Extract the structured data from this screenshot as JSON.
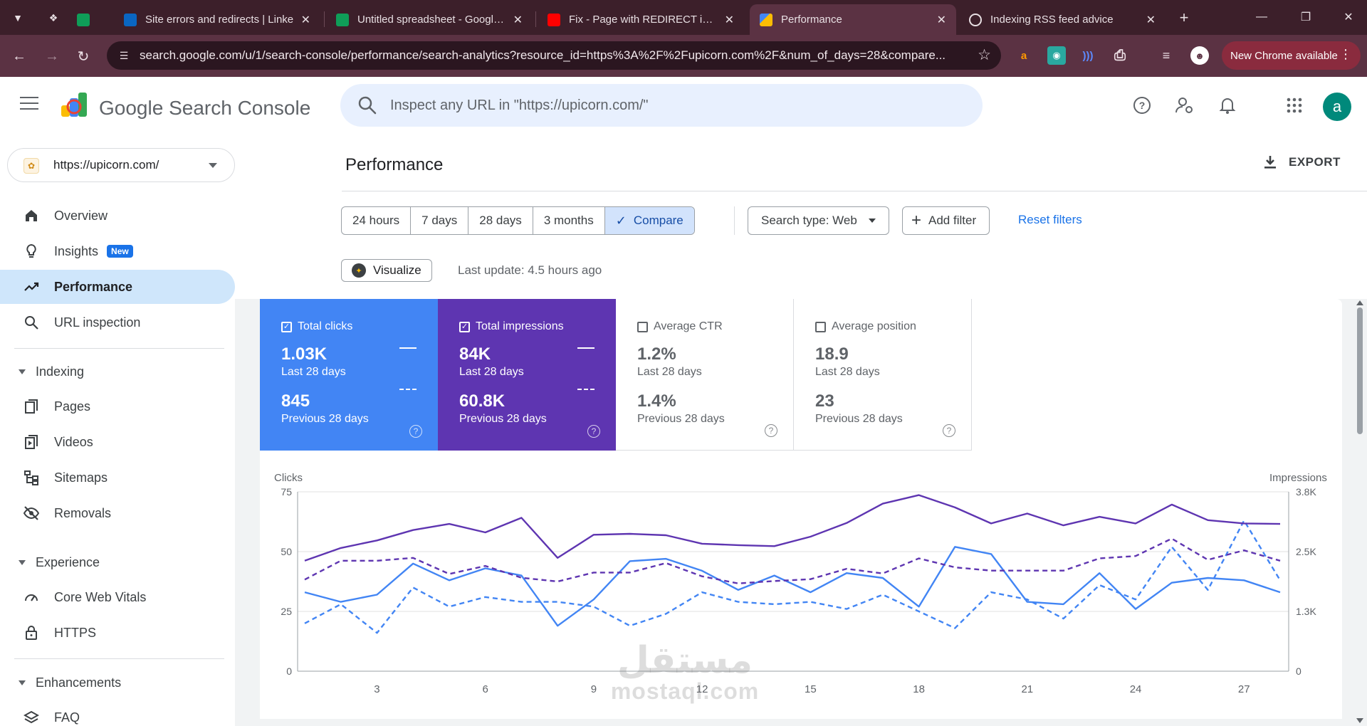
{
  "browser": {
    "tabs": [
      {
        "title": "Site errors and redirects | Linke",
        "icon": "linkedin-video-icon",
        "color": "#0a66c2"
      },
      {
        "title": "Untitled spreadsheet - Google S",
        "icon": "sheets-icon",
        "color": "#0f9d58"
      },
      {
        "title": "Fix - Page with REDIRECT in Go",
        "icon": "youtube-icon",
        "color": "#ff0000"
      },
      {
        "title": "Performance",
        "icon": "search-console-icon",
        "color": "#4285f4"
      },
      {
        "title": "Indexing RSS feed advice",
        "icon": "openai-icon",
        "color": "#e8dfe3"
      }
    ],
    "url": "search.google.com/u/1/search-console/performance/search-analytics?resource_id=https%3A%2F%2Fupicorn.com%2F&num_of_days=28&compare...",
    "update_label": "New Chrome available"
  },
  "header": {
    "app_name": "Google Search Console",
    "search_placeholder": "Inspect any URL in \"https://upicorn.com/\"",
    "avatar_letter": "a"
  },
  "sidebar": {
    "property": "https://upicorn.com/",
    "items": {
      "overview": "Overview",
      "insights": "Insights",
      "insights_badge": "New",
      "performance": "Performance",
      "url_inspection": "URL inspection"
    },
    "indexing": {
      "title": "Indexing",
      "pages": "Pages",
      "videos": "Videos",
      "sitemaps": "Sitemaps",
      "removals": "Removals"
    },
    "experience": {
      "title": "Experience",
      "cwv": "Core Web Vitals",
      "https": "HTTPS"
    },
    "enhancements": {
      "title": "Enhancements",
      "faq": "FAQ"
    }
  },
  "main": {
    "title": "Performance",
    "export_label": "EXPORT",
    "date_options": [
      "24 hours",
      "7 days",
      "28 days",
      "3 months",
      "Compare"
    ],
    "search_type": "Search type: Web",
    "add_filter": "Add filter",
    "reset_filters": "Reset filters",
    "visualize": "Visualize",
    "last_update": "Last update: 4.5 hours ago"
  },
  "metrics": [
    {
      "label": "Total clicks",
      "value": "1.03K",
      "period": "Last 28 days",
      "prev_value": "845",
      "prev_period": "Previous 28 days",
      "checked": true,
      "color": "#4285f4"
    },
    {
      "label": "Total impressions",
      "value": "84K",
      "period": "Last 28 days",
      "prev_value": "60.8K",
      "prev_period": "Previous 28 days",
      "checked": true,
      "color": "#5e35b1"
    },
    {
      "label": "Average CTR",
      "value": "1.2%",
      "period": "Last 28 days",
      "prev_value": "1.4%",
      "prev_period": "Previous 28 days",
      "checked": false
    },
    {
      "label": "Average position",
      "value": "18.9",
      "period": "Last 28 days",
      "prev_value": "23",
      "prev_period": "Previous 28 days",
      "checked": false
    }
  ],
  "chart_data": {
    "type": "line",
    "ylabel": "Clicks",
    "y2label": "Impressions",
    "ylim": [
      0,
      75
    ],
    "y2lim": [
      0,
      3800
    ],
    "yticks": [
      "0",
      "25",
      "50",
      "75"
    ],
    "y2ticks": [
      "0",
      "1.3K",
      "2.5K",
      "3.8K"
    ],
    "x": [
      1,
      2,
      3,
      4,
      5,
      6,
      7,
      8,
      9,
      10,
      11,
      12,
      13,
      14,
      15,
      16,
      17,
      18,
      19,
      20,
      21,
      22,
      23,
      24,
      25,
      26,
      27,
      28
    ],
    "xticks": [
      "3",
      "6",
      "9",
      "12",
      "15",
      "18",
      "21",
      "24",
      "27"
    ],
    "xtick_values": [
      3,
      6,
      9,
      12,
      15,
      18,
      21,
      24,
      27
    ],
    "series": [
      {
        "name": "Total clicks",
        "axis": "left",
        "dashed": false,
        "color": "#4285f4",
        "values": [
          33,
          29,
          32,
          45,
          38,
          43,
          40,
          19,
          30,
          46,
          47,
          42,
          34,
          40,
          33,
          41,
          39,
          27,
          52,
          49,
          29,
          28,
          41,
          26,
          37,
          39,
          38,
          33
        ]
      },
      {
        "name": "Total clicks",
        "axis": "left",
        "dashed": true,
        "color": "#4285f4",
        "values": [
          20,
          28,
          16,
          35,
          27,
          31,
          29,
          29,
          27,
          19,
          24,
          33,
          29,
          28,
          29,
          26,
          32,
          25,
          18,
          33,
          30,
          22,
          36,
          30,
          52,
          34,
          63,
          38
        ]
      },
      {
        "name": "Total impressions",
        "axis": "right",
        "dashed": false,
        "color": "#5e35b1",
        "values": [
          2340,
          2610,
          2770,
          2990,
          3120,
          2940,
          3250,
          2400,
          2890,
          2910,
          2880,
          2700,
          2670,
          2650,
          2850,
          3140,
          3550,
          3730,
          3470,
          3130,
          3340,
          3090,
          3270,
          3130,
          3530,
          3200,
          3130,
          3120
        ]
      },
      {
        "name": "Total impressions",
        "axis": "right",
        "dashed": true,
        "color": "#5e35b1",
        "values": [
          1940,
          2340,
          2340,
          2400,
          2060,
          2230,
          1980,
          1900,
          2090,
          2090,
          2290,
          2010,
          1860,
          1910,
          1950,
          2170,
          2070,
          2390,
          2200,
          2130,
          2130,
          2130,
          2390,
          2440,
          2810,
          2360,
          2560,
          2340
        ]
      }
    ]
  }
}
